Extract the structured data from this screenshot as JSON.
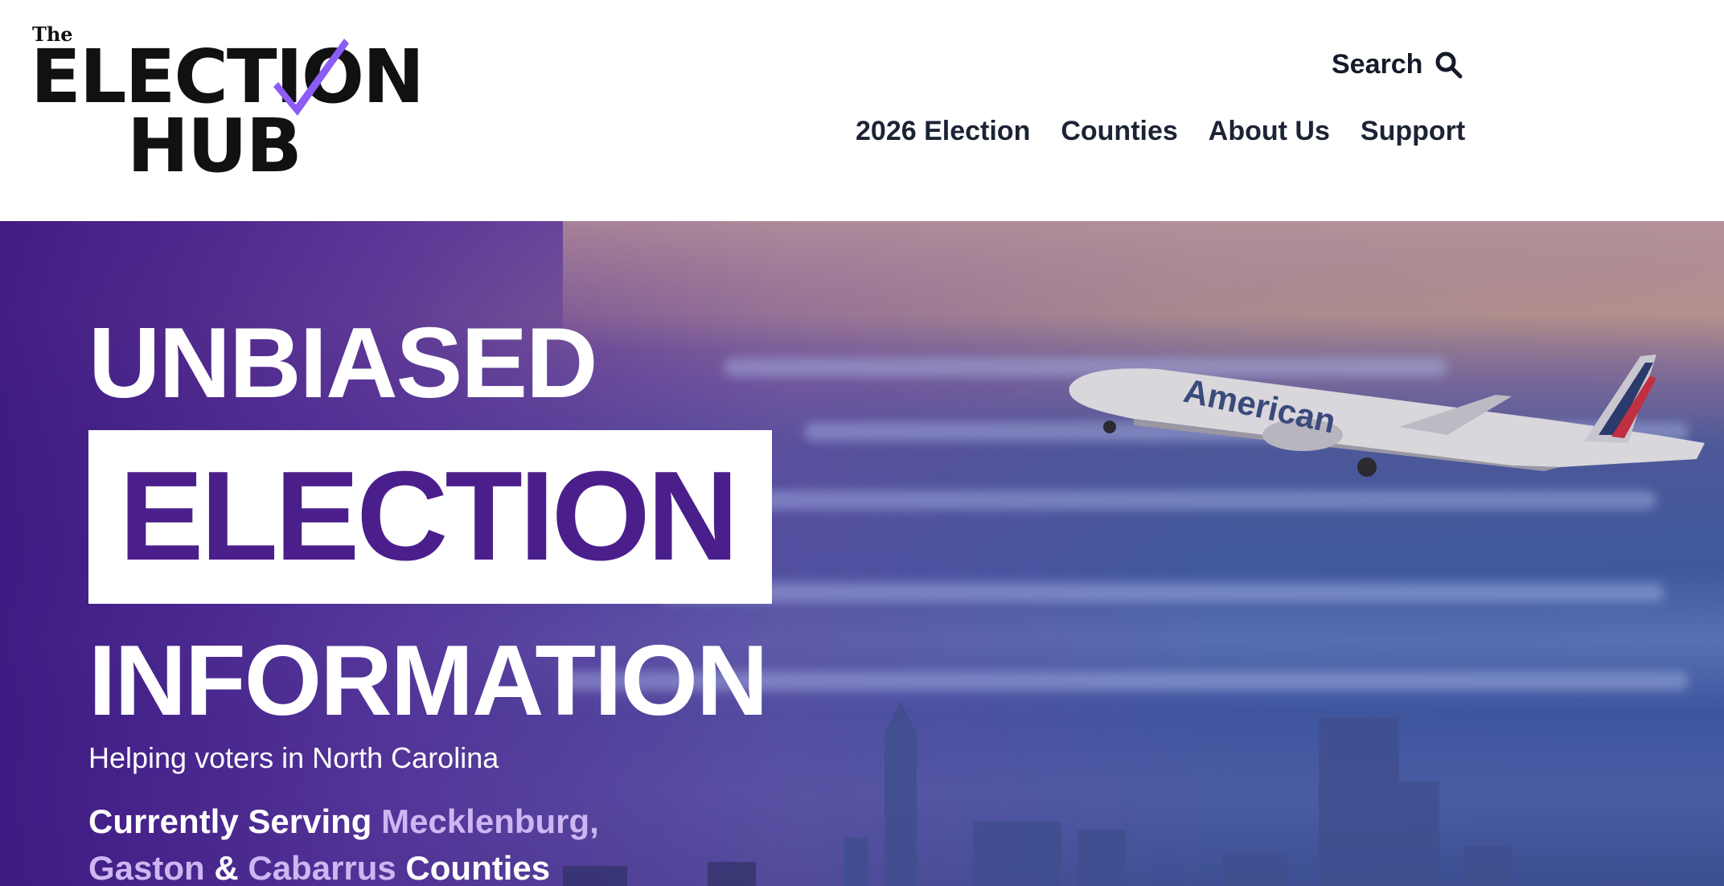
{
  "logo": {
    "the": "The",
    "line1": "ELECTION",
    "line2": "HUB",
    "check_color": "#8b5cf6"
  },
  "header": {
    "search_label": "Search",
    "search_icon": "search-icon",
    "nav": [
      "2026 Election",
      "Counties",
      "About Us",
      "Support"
    ]
  },
  "hero": {
    "line1": "UNBIASED",
    "line2": "ELECTION",
    "line3": "INFORMATION",
    "subtitle": "Helping voters in North Carolina",
    "serving_prefix": "Currently Serving ",
    "county1": "Mecklenburg,",
    "county2": "Gaston",
    "amp": " & ",
    "county3": "Cabarrus",
    "serving_suffix": " Counties",
    "plane_livery": "American",
    "accent_purple": "#4a1f8c",
    "highlight_color": "#cdb6f2"
  }
}
